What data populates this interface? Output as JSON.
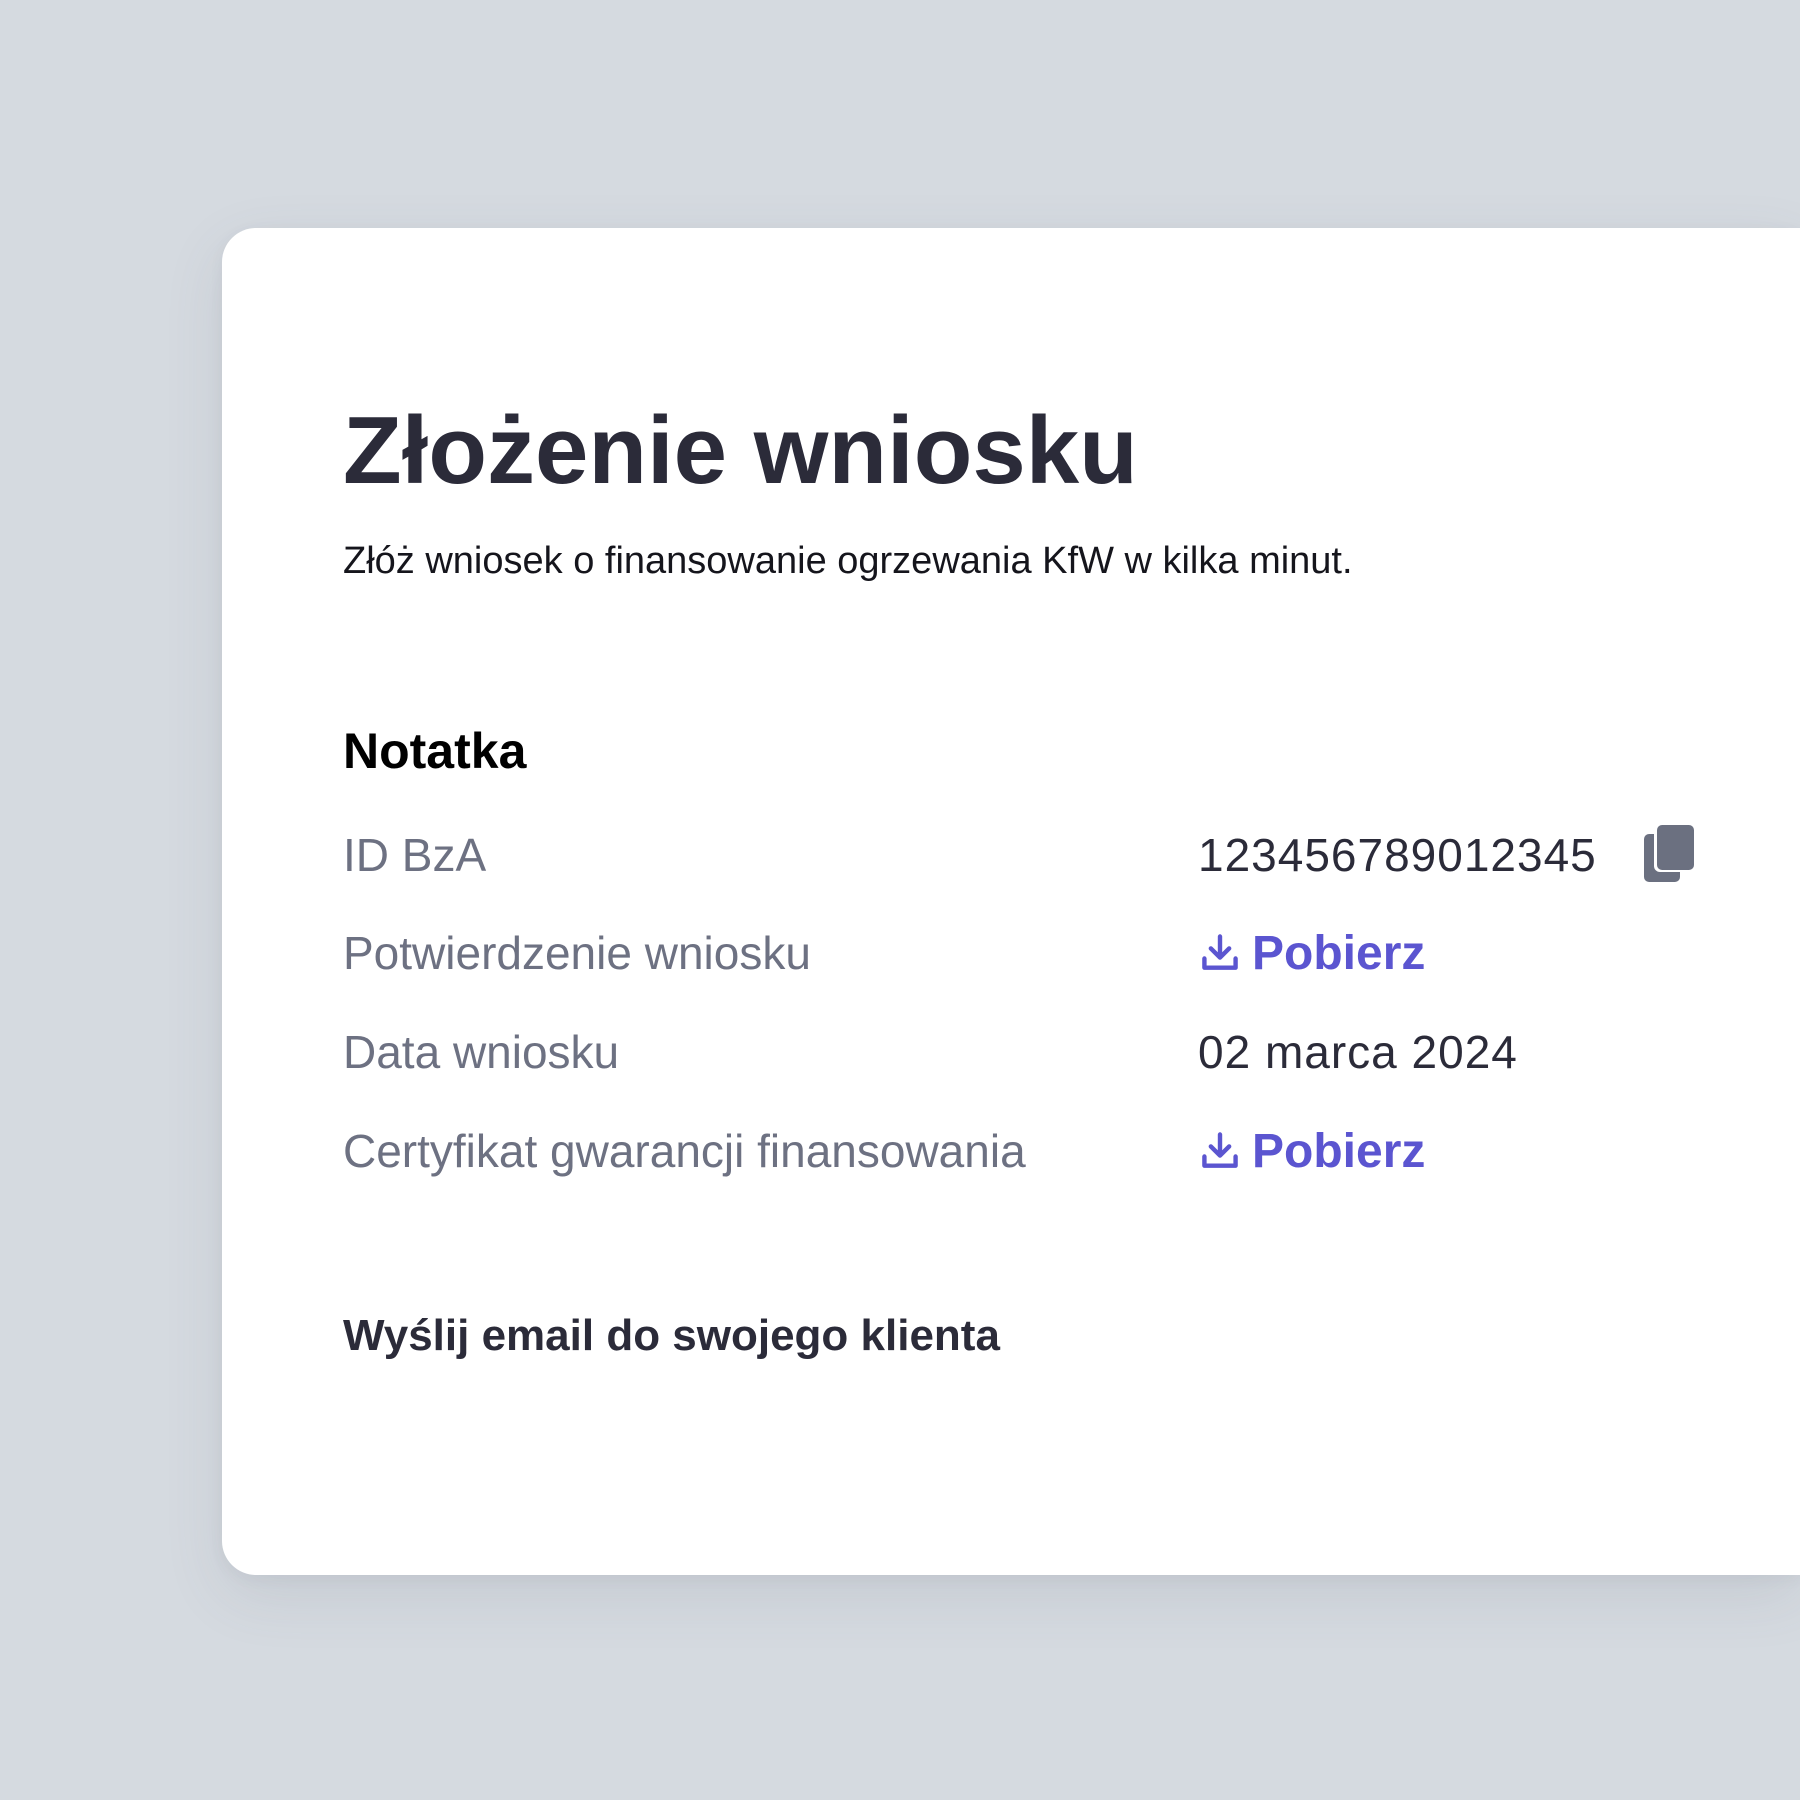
{
  "header": {
    "title": "Złożenie wniosku",
    "subtitle": "Złóż wniosek o finansowanie ogrzewania KfW w kilka minut."
  },
  "note": {
    "heading": "Notatka",
    "rows": [
      {
        "label": "ID BzA",
        "value": "123456789012345",
        "action": "copy-icon"
      },
      {
        "label": "Potwierdzenie wniosku",
        "link_label": "Pobierz",
        "action": "download-icon"
      },
      {
        "label": "Data wniosku",
        "value": "02 marca 2024"
      },
      {
        "label": "Certyfikat gwarancji finansowania",
        "link_label": "Pobierz",
        "action": "download-icon"
      }
    ]
  },
  "email": {
    "heading": "Wyślij email do swojego klienta"
  },
  "colors": {
    "background": "#d5dae0",
    "card": "#ffffff",
    "title": "#2b2b39",
    "label": "#6d7182",
    "accent": "#5b55d0",
    "icon_gray": "#6b7080"
  }
}
